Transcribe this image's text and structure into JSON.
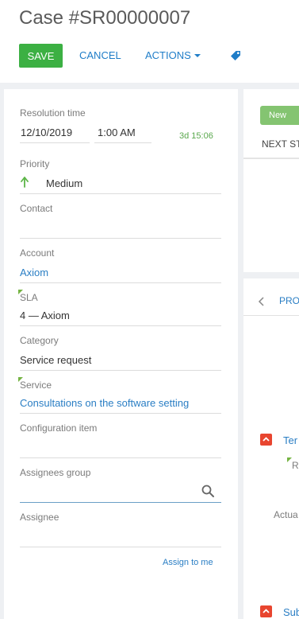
{
  "header": {
    "title": "Case #SR00000007",
    "save_label": "SAVE",
    "cancel_label": "CANCEL",
    "actions_label": "ACTIONS"
  },
  "fields": {
    "resolution_time": {
      "label": "Resolution time",
      "date": "12/10/2019",
      "time": "1:00 AM",
      "remaining": "3d 15:06"
    },
    "priority": {
      "label": "Priority",
      "value": "Medium"
    },
    "contact": {
      "label": "Contact",
      "value": ""
    },
    "account": {
      "label": "Account",
      "value": "Axiom"
    },
    "sla": {
      "label": "SLA",
      "value": "4 — Axiom"
    },
    "category": {
      "label": "Category",
      "value": "Service request"
    },
    "service": {
      "label": "Service",
      "value": "Consultations on the software setting"
    },
    "configuration_item": {
      "label": "Configuration item",
      "value": ""
    },
    "assignees_group": {
      "label": "Assignees group",
      "value": ""
    },
    "assignee": {
      "label": "Assignee",
      "value": "",
      "assign_to_me": "Assign to me"
    }
  },
  "right_panel": {
    "stage": "New",
    "next_steps": "NEXT ST",
    "tab_label": "PRO",
    "item1_link": "Ter",
    "item1_sub": "R",
    "actual_label": "Actua",
    "item2_link": "Sub"
  },
  "colors": {
    "save_button": "#3cb043",
    "link": "#2a7ec4",
    "stage_new": "#84c471",
    "required_marker": "#75b443",
    "red_icon": "#e8452f"
  },
  "icons": {
    "tag": "tag-icon",
    "priority_arrow": "arrow-up-icon",
    "search": "search-icon",
    "back": "chevron-left-icon"
  }
}
